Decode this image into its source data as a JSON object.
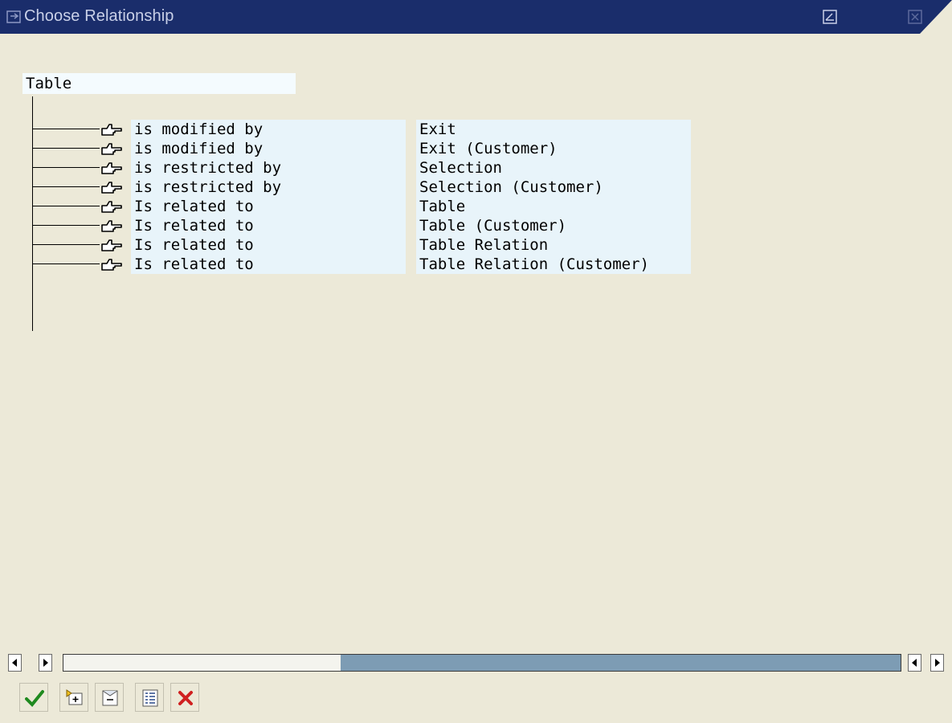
{
  "window": {
    "title": "Choose Relationship",
    "title_icon": "hand-pointer-icon",
    "buttons": [
      "restore-icon",
      "close-icon"
    ]
  },
  "tree": {
    "root_label": "Table",
    "rows": [
      {
        "relation": "is modified by",
        "object": "Exit"
      },
      {
        "relation": "is modified by",
        "object": "Exit (Customer)"
      },
      {
        "relation": "is restricted by",
        "object": "Selection"
      },
      {
        "relation": "is restricted by",
        "object": "Selection (Customer)"
      },
      {
        "relation": "Is related to",
        "object": "Table"
      },
      {
        "relation": "Is related to",
        "object": "Table (Customer)"
      },
      {
        "relation": "Is related to",
        "object": "Table Relation"
      },
      {
        "relation": "Is related to",
        "object": "Table Relation (Customer)"
      }
    ]
  },
  "toolbar": {
    "buttons": [
      "check-icon",
      "expand-node-icon",
      "collapse-node-icon",
      "details-icon",
      "cancel-icon"
    ]
  },
  "colors": {
    "titlebar": "#1a2d6b",
    "background": "#ece9d8",
    "cell_highlight": "#e8f4fa",
    "scroll_track": "#7d9cb4"
  }
}
